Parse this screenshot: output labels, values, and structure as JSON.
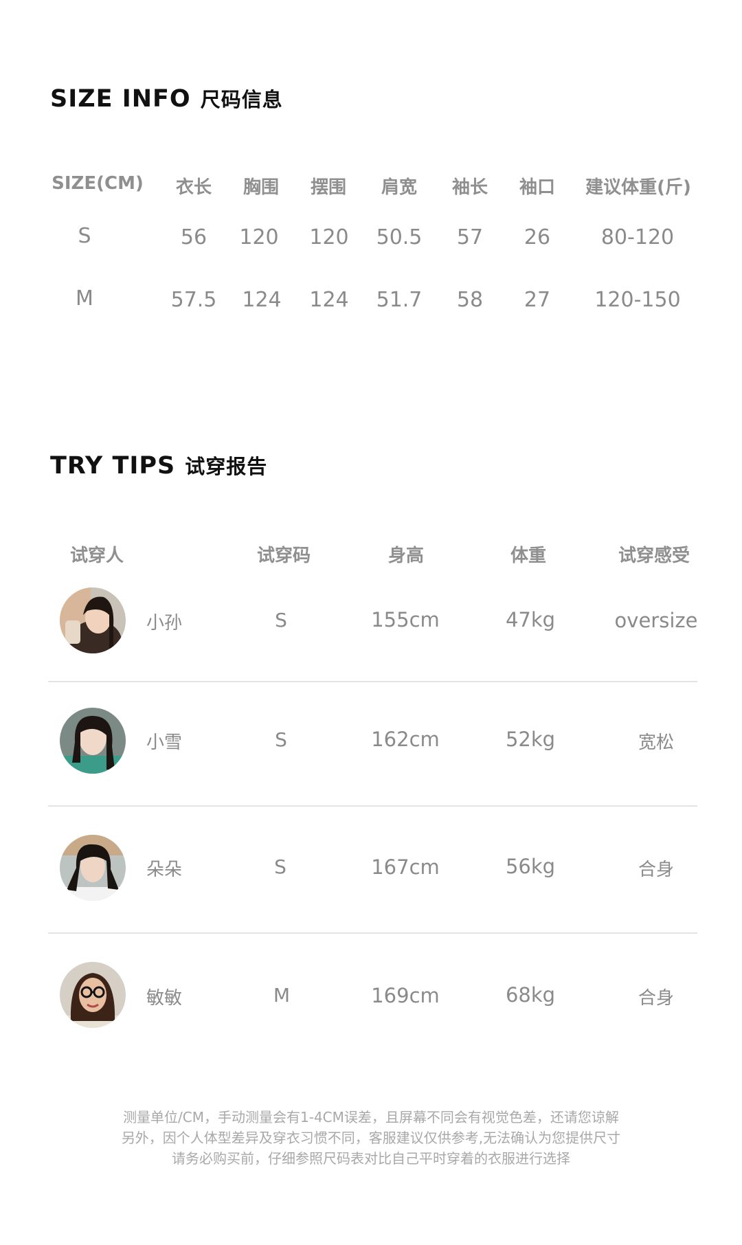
{
  "size_info": {
    "title_en": "SIZE INFO",
    "title_cn": "尺码信息",
    "headers": [
      "SIZE(CM)",
      "衣长",
      "胸围",
      "摆围",
      "肩宽",
      "袖长",
      "袖口",
      "建议体重(斤)"
    ],
    "rows": [
      [
        "S",
        "56",
        "120",
        "120",
        "50.5",
        "57",
        "26",
        "80-120"
      ],
      [
        "M",
        "57.5",
        "124",
        "124",
        "51.7",
        "58",
        "27",
        "120-150"
      ]
    ]
  },
  "try_tips": {
    "title_en": "TRY TIPS",
    "title_cn": "试穿报告",
    "headers": [
      "试穿人",
      "试穿码",
      "身高",
      "体重",
      "试穿感受"
    ],
    "rows": [
      {
        "name": "小孙",
        "size": "S",
        "height": "155cm",
        "weight": "47kg",
        "feel": "oversize"
      },
      {
        "name": "小雪",
        "size": "S",
        "height": "162cm",
        "weight": "52kg",
        "feel": "宽松"
      },
      {
        "name": "朵朵",
        "size": "S",
        "height": "167cm",
        "weight": "56kg",
        "feel": "合身"
      },
      {
        "name": "敏敏",
        "size": "M",
        "height": "169cm",
        "weight": "68kg",
        "feel": "合身"
      }
    ]
  },
  "note_lines": [
    "测量单位/CM，手动测量会有1-4CM误差，且屏幕不同会有视觉色差，还请您谅解",
    "另外，因个人体型差异及穿衣习惯不同，客服建议仅供参考,无法确认为您提供尺寸",
    "请务必购买前，仔细参照尺码表对比自己平时穿着的衣服进行选择"
  ]
}
